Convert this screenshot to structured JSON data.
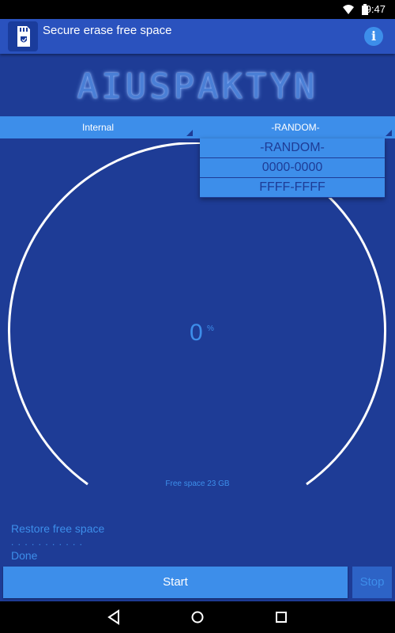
{
  "status_bar": {
    "time": "9:47",
    "icons": [
      "wifi-icon",
      "battery-icon"
    ]
  },
  "action_bar": {
    "title": "Secure erase free space",
    "app_icon": "sd-card-shield-icon",
    "info_icon": "info-icon",
    "info_glyph": "i"
  },
  "logo": {
    "text": "AIUSPAKTYN"
  },
  "selectors": {
    "storage": "Internal",
    "pattern": "-RANDOM-"
  },
  "dropdown": {
    "options": [
      "-RANDOM-",
      "0000-0000",
      "FFFF-FFFF"
    ]
  },
  "progress": {
    "value": "0",
    "unit": "%",
    "fraction": 0
  },
  "free_space": "Free space 23 GB",
  "status": {
    "line1": "Restore free space",
    "dots": ". . . . . . . . . . .",
    "line3": "Done"
  },
  "buttons": {
    "start": "Start",
    "stop": "Stop"
  },
  "colors": {
    "background": "#1e3c96",
    "accent": "#3d8eea",
    "action_bar": "#2a52be"
  },
  "nav": [
    "back-icon",
    "home-icon",
    "recents-icon"
  ]
}
